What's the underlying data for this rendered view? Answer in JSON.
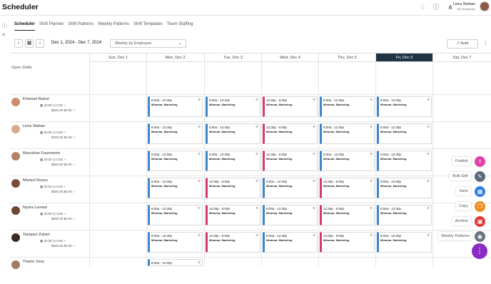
{
  "app": {
    "title": "Scheduler"
  },
  "user": {
    "name": "Liora Steban",
    "org": "MC Enterprise"
  },
  "tabs": [
    {
      "label": "Scheduler",
      "active": true
    },
    {
      "label": "Shift Planner"
    },
    {
      "label": "Shift Patterns"
    },
    {
      "label": "Weekly Patterns"
    },
    {
      "label": "Shift Templates"
    },
    {
      "label": "Team Staffing"
    }
  ],
  "toolbar": {
    "date_range": "Dec 1, 2024 - Dec 7, 2024",
    "view": "Weekly by Employee",
    "auto_label": "Auto"
  },
  "days": [
    {
      "label": "Sun, Dec 1"
    },
    {
      "label": "Mon, Dec 2"
    },
    {
      "label": "Tue, Dec 3"
    },
    {
      "label": "Wed, Dec 4"
    },
    {
      "label": "Thu, Dec 5"
    },
    {
      "label": "Fri, Dec 6",
      "today": true
    },
    {
      "label": "Sat, Dec 7"
    }
  ],
  "open_shifts_label": "Open Shifts",
  "employees": [
    {
      "name": "Khamari Balozi",
      "hours": "20:00",
      "ot": "0:00",
      "pay": "$500.00",
      "extra": "$0.00",
      "shifts": [
        {
          "day": 1,
          "time": "8:00a - 12:30p",
          "location": "Miramar, Marketing",
          "color": "blue"
        },
        {
          "day": 2,
          "time": "8:00a - 12:30p",
          "location": "Miramar, Marketing",
          "color": "blue"
        },
        {
          "day": 3,
          "time": "12:30p - 5:00p",
          "location": "Miramar, Marketing",
          "color": "red"
        },
        {
          "day": 4,
          "time": "8:00a - 12:30p",
          "location": "Miramar, Marketing",
          "color": "blue"
        },
        {
          "day": 5,
          "time": "8:00a - 12:30p",
          "location": "Miramar, Marketing",
          "color": "blue"
        }
      ]
    },
    {
      "name": "Liora Steban",
      "hours": "20:00",
      "ot": "0:00",
      "pay": "$700.00",
      "extra": "$0.00",
      "shifts": [
        {
          "day": 1,
          "time": "8:00a - 12:30p",
          "location": "Miramar, Marketing",
          "color": "blue"
        },
        {
          "day": 2,
          "time": "8:00a - 12:30p",
          "location": "Miramar, Marketing",
          "color": "blue"
        },
        {
          "day": 3,
          "time": "12:30p - 5:00p",
          "location": "Miramar, Marketing",
          "color": "red"
        },
        {
          "day": 4,
          "time": "8:00a - 12:30p",
          "location": "Miramar, Marketing",
          "color": "blue"
        },
        {
          "day": 5,
          "time": "8:00a - 12:30p",
          "location": "Miramar, Marketing",
          "color": "blue"
        }
      ]
    },
    {
      "name": "Marceline Fauremont",
      "hours": "20:00",
      "ot": "0:00",
      "pay": "$500.00",
      "extra": "$0.00",
      "shifts": [
        {
          "day": 1,
          "time": "8:00a - 12:30p",
          "location": "Miramar, Marketing",
          "color": "blue"
        },
        {
          "day": 2,
          "time": "8:00a - 12:30p",
          "location": "Miramar, Marketing",
          "color": "blue"
        },
        {
          "day": 3,
          "time": "12:30p - 5:00p",
          "location": "Miramar, Marketing",
          "color": "red"
        },
        {
          "day": 4,
          "time": "8:00a - 12:30p",
          "location": "Miramar, Marketing",
          "color": "blue"
        },
        {
          "day": 5,
          "time": "8:00a - 12:30p",
          "location": "Miramar, Marketing",
          "color": "blue"
        }
      ]
    },
    {
      "name": "Marisol Reyes",
      "hours": "20:00",
      "ot": "0:00",
      "pay": "$500.00",
      "extra": "$0.00",
      "shifts": [
        {
          "day": 1,
          "time": "8:00a - 12:30p",
          "location": "Miramar, Marketing",
          "color": "blue"
        },
        {
          "day": 2,
          "time": "12:30p - 5:00p",
          "location": "Miramar, Marketing",
          "color": "red"
        },
        {
          "day": 3,
          "time": "8:00a - 12:30p",
          "location": "Miramar, Marketing",
          "color": "blue"
        },
        {
          "day": 4,
          "time": "12:30p - 5:00p",
          "location": "Miramar, Marketing",
          "color": "red"
        },
        {
          "day": 5,
          "time": "8:00a - 12:30p",
          "location": "Miramar, Marketing",
          "color": "blue"
        }
      ]
    },
    {
      "name": "Nyara Lumasi",
      "hours": "20:00",
      "ot": "0:00",
      "pay": "$500.00",
      "extra": "$0.00",
      "shifts": [
        {
          "day": 1,
          "time": "8:00a - 12:30p",
          "location": "Miramar, Marketing",
          "color": "blue"
        },
        {
          "day": 2,
          "time": "12:30p - 5:00p",
          "location": "Miramar, Marketing",
          "color": "red"
        },
        {
          "day": 3,
          "time": "8:00a - 12:30p",
          "location": "Miramar, Marketing",
          "color": "blue"
        },
        {
          "day": 4,
          "time": "12:30p - 5:00p",
          "location": "Miramar, Marketing",
          "color": "red"
        },
        {
          "day": 5,
          "time": "8:00a - 12:30p",
          "location": "Miramar, Marketing",
          "color": "blue"
        }
      ]
    },
    {
      "name": "Taniqani Zubari",
      "hours": "20:00",
      "ot": "0:00",
      "pay": "$500.00",
      "extra": "$0.00",
      "shifts": [
        {
          "day": 1,
          "time": "8:00a - 12:30p",
          "location": "Miramar, Marketing",
          "color": "blue"
        },
        {
          "day": 2,
          "time": "12:30p - 5:00p",
          "location": "Miramar, Marketing",
          "color": "red"
        },
        {
          "day": 3,
          "time": "8:00a - 12:30p",
          "location": "Miramar, Marketing",
          "color": "blue"
        },
        {
          "day": 4,
          "time": "12:30p - 5:00p",
          "location": "Miramar, Marketing",
          "color": "red"
        },
        {
          "day": 5,
          "time": "8:00a - 12:30p",
          "location": "Miramar, Marketing",
          "color": "blue"
        }
      ]
    },
    {
      "name": "Thalric Voss",
      "hours": "",
      "ot": "",
      "pay": "",
      "extra": "",
      "shifts": [
        {
          "day": 1,
          "time": "8:00a - 12:30p",
          "location": "",
          "color": "blue"
        }
      ]
    }
  ],
  "fab_actions": [
    {
      "label": "Publish",
      "icon": "publish-icon",
      "color": "#e23fa8"
    },
    {
      "label": "Bulk Edit",
      "icon": "pencil-icon",
      "color": "#5a6a7a"
    },
    {
      "label": "Save",
      "icon": "save-icon",
      "color": "#2f7de0"
    },
    {
      "label": "Copy",
      "icon": "copy-icon",
      "color": "#f08a1c"
    },
    {
      "label": "Archive",
      "icon": "archive-icon",
      "color": "#e03a3a"
    },
    {
      "label": "Weekly Patterns",
      "icon": "pattern-icon",
      "color": "#6a7480"
    }
  ],
  "colors": {
    "today_header": "#1e3344",
    "shift_blue": "#3a86c8",
    "shift_red": "#d43a6a",
    "fab_main": "#8a2cc2"
  }
}
